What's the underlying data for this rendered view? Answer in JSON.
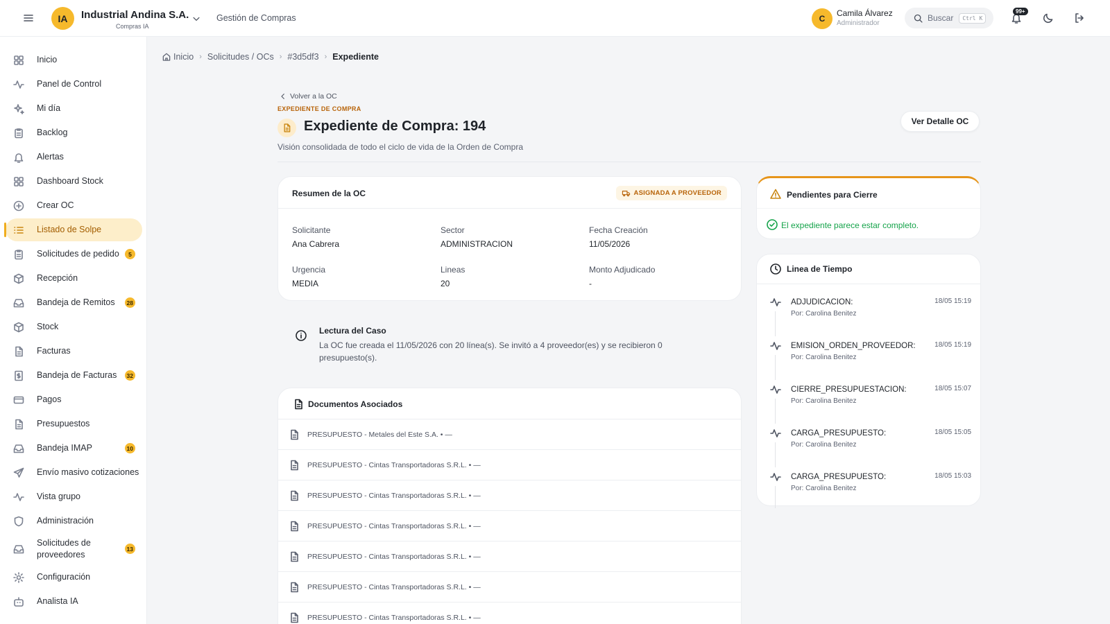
{
  "topbar": {
    "logo": "IA",
    "company": "Industrial Andina S.A.",
    "company_sub": "Compras IA",
    "module": "Gestión de Compras",
    "user_initial": "C",
    "user_name": "Camila Álvarez",
    "user_role": "Administrador",
    "search_label": "Buscar",
    "search_shortcut": "Ctrl K",
    "notif_count": "99+"
  },
  "sidebar": {
    "items": [
      {
        "label": "Inicio",
        "icon": "grid-icon"
      },
      {
        "label": "Panel de Control",
        "icon": "activity-icon"
      },
      {
        "label": "Mi día",
        "icon": "sparkles-icon"
      },
      {
        "label": "Backlog",
        "icon": "clipboard-icon"
      },
      {
        "label": "Alertas",
        "icon": "bell-icon"
      },
      {
        "label": "Dashboard Stock",
        "icon": "grid-icon"
      },
      {
        "label": "Crear OC",
        "icon": "plus-circle-icon"
      },
      {
        "label": "Listado de Solpe",
        "icon": "list-icon",
        "active": true
      },
      {
        "label": "Solicitudes de pedido",
        "icon": "clipboard-icon",
        "badge": "5"
      },
      {
        "label": "Recepción",
        "icon": "package-icon"
      },
      {
        "label": "Bandeja de Remitos",
        "icon": "inbox-icon",
        "badge": "28"
      },
      {
        "label": "Stock",
        "icon": "package-icon"
      },
      {
        "label": "Facturas",
        "icon": "file-icon"
      },
      {
        "label": "Bandeja de Facturas",
        "icon": "dollar-file-icon",
        "badge": "32"
      },
      {
        "label": "Pagos",
        "icon": "credit-card-icon"
      },
      {
        "label": "Presupuestos",
        "icon": "file-icon"
      },
      {
        "label": "Bandeja IMAP",
        "icon": "inbox-icon",
        "badge": "10"
      },
      {
        "label": "Envío masivo cotizaciones",
        "icon": "send-icon"
      },
      {
        "label": "Vista grupo",
        "icon": "activity-icon"
      },
      {
        "label": "Administración",
        "icon": "shield-icon"
      },
      {
        "label": "Solicitudes de proveedores",
        "icon": "inbox-icon",
        "badge": "13"
      },
      {
        "label": "Configuración",
        "icon": "gear-icon"
      },
      {
        "label": "Analista IA",
        "icon": "bot-icon"
      }
    ]
  },
  "breadcrumb": [
    "Inicio",
    "Solicitudes / OCs",
    "#3d5df3",
    "Expediente"
  ],
  "header": {
    "back": "Volver a la OC",
    "eyebrow": "EXPEDIENTE DE COMPRA",
    "title": "Expediente de Compra: 194",
    "subtitle": "Visión consolidada de todo el ciclo de vida de la Orden de Compra",
    "detail_button": "Ver Detalle OC"
  },
  "summary": {
    "title": "Resumen de la OC",
    "status": "ASIGNADA A PROVEEDOR",
    "fields": [
      {
        "label": "Solicitante",
        "value": "Ana Cabrera"
      },
      {
        "label": "Sector",
        "value": "ADMINISTRACION"
      },
      {
        "label": "Fecha Creación",
        "value": "11/05/2026"
      },
      {
        "label": "Urgencia",
        "value": "MEDIA"
      },
      {
        "label": "Lineas",
        "value": "20"
      },
      {
        "label": "Monto Adjudicado",
        "value": "-"
      }
    ]
  },
  "case_note": {
    "title": "Lectura del Caso",
    "body": "La OC fue creada el 11/05/2026 con 20 línea(s). Se invitó a 4 proveedor(es) y se recibieron 0 presupuesto(s)."
  },
  "documents": {
    "title": "Documentos Asociados",
    "items": [
      "PRESUPUESTO - Metales del Este S.A. • —",
      "PRESUPUESTO - Cintas Transportadoras S.R.L. • —",
      "PRESUPUESTO - Cintas Transportadoras S.R.L. • —",
      "PRESUPUESTO - Cintas Transportadoras S.R.L. • —",
      "PRESUPUESTO - Cintas Transportadoras S.R.L. • —",
      "PRESUPUESTO - Cintas Transportadoras S.R.L. • —",
      "PRESUPUESTO - Cintas Transportadoras S.R.L. • —"
    ]
  },
  "pending": {
    "title": "Pendientes para Cierre",
    "message": "El expediente parece estar completo.",
    "ok_color": "#15a34a",
    "accent": "#e6951a"
  },
  "timeline": {
    "title": "Linea de Tiempo",
    "events": [
      {
        "event": "ADJUDICACION:",
        "by": "Por: Carolina Benitez",
        "time": "18/05 15:19"
      },
      {
        "event": "EMISION_ORDEN_PROVEEDOR:",
        "by": "Por: Carolina Benitez",
        "time": "18/05 15:19"
      },
      {
        "event": "CIERRE_PRESUPUESTACION:",
        "by": "Por: Carolina Benitez",
        "time": "18/05 15:07"
      },
      {
        "event": "CARGA_PRESUPUESTO:",
        "by": "Por: Carolina Benitez",
        "time": "18/05 15:05"
      },
      {
        "event": "CARGA_PRESUPUESTO:",
        "by": "Por: Carolina Benitez",
        "time": "18/05 15:03"
      }
    ]
  }
}
